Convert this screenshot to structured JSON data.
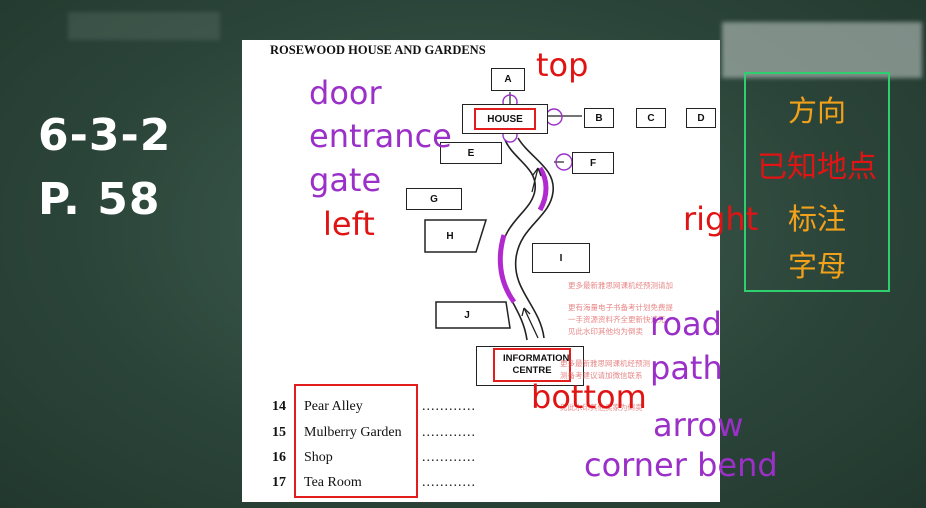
{
  "slide": {
    "code": "6-3-2",
    "page": "P. 58"
  },
  "map": {
    "title": "ROSEWOOD HOUSE AND GARDENS",
    "buildings": {
      "a": "A",
      "house": "HOUSE",
      "b": "B",
      "c": "C",
      "d": "D",
      "e": "E",
      "f": "F",
      "g": "G",
      "h": "H",
      "i": "I",
      "j": "J",
      "info": "INFORMATION CENTRE"
    }
  },
  "questions": [
    {
      "num": "14",
      "label": "Pear Alley",
      "answer": "............"
    },
    {
      "num": "15",
      "label": "Mulberry Garden",
      "answer": "............"
    },
    {
      "num": "16",
      "label": "Shop",
      "answer": "............"
    },
    {
      "num": "17",
      "label": "Tea Room",
      "answer": "............"
    }
  ],
  "annotations": {
    "top": "top",
    "door": "door",
    "entrance": "entrance",
    "gate": "gate",
    "left": "left",
    "right": "right",
    "road": "road",
    "path": "path",
    "bottom": "bottom",
    "arrow": "arrow",
    "corner_bend": "corner bend"
  },
  "tips": {
    "line1": "方向",
    "line2": "已知地点",
    "line3": "标注",
    "line4": "字母"
  },
  "watermarks": [
    "更多最新雅思网课机经预测请加",
    "更有海量电子书备考计划免费提",
    "一手资源资料齐全更新快速无",
    "见此水印其他均为倒卖",
    "更多最新雅思网课机经预测",
    "测备考建议请加微信联系",
    "见此水印其他卖家为倒卖"
  ],
  "colors": {
    "background": "#2b4439",
    "annotation_purple": "#9b30c8",
    "annotation_red": "#e01414",
    "highlight_red": "#e11d1d",
    "tip_orange": "#f2a21a",
    "tip_red": "#e01414",
    "tip_border_green": "#2fcf70",
    "path_highlight": "#b02ad0"
  }
}
